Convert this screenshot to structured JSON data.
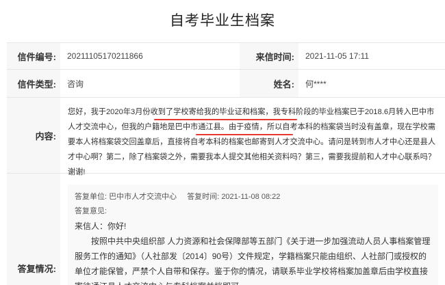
{
  "title": "自考毕业生档案",
  "fields": {
    "letter_no_label": "信件编号:",
    "letter_no_value": "20211105170211866",
    "received_time_label": "来信时间:",
    "received_time_value": "2021-11-05 17:11",
    "letter_type_label": "信件类型:",
    "letter_type_value": "咨询",
    "name_label": "姓名:",
    "name_value": "何****",
    "content_label": "内容:",
    "reply_label": "答复情况:"
  },
  "content": {
    "text": "您好，我于2020年3月份收到了学校寄给我的毕业证和档案，我专科阶段的毕业档案已于2018.6月转入巴中市人才交流中心，但我的户籍地是巴中市通江县。由于疫情，所以自考本科的档案袋当时没有盖章，现在学校需要本人将档案袋交回盖章后，直接将自考本科的档案也邮寄到人才交流中心。请问是转到市人才中心还是县人才中心啊？第二，除了档案袋之外，需要我本人提交其他相关资料吗？第三，需要我提前和人才中心联系吗？谢谢!"
  },
  "reply": {
    "unit_label": "答复单位:",
    "unit_value": "巴中市人才交流中心",
    "time_label": "答复时间:",
    "time_value": "2021-11-08 08:22",
    "opinion_label": "答复意见:",
    "greeting": "来信人：你好!",
    "body": "按照中共中央组织部 人力资源和社会保障部等五部门《关于进一步加强流动人员人事档案管理服务工作的通知》（人社部发〔2014〕90号）文件规定，学籍档案只能由组织、人社部门或授权的单位才能保管，严禁个人自带和保存。鉴于你的情况，请联系毕业学校将档案加盖章后由学校直接寄往通江县人才交流中心与专科档案并档即可。"
  },
  "colors": {
    "underline": "#e8372f",
    "label_bg": "#f7f7f7",
    "reply_bg": "#f9f9f9"
  }
}
